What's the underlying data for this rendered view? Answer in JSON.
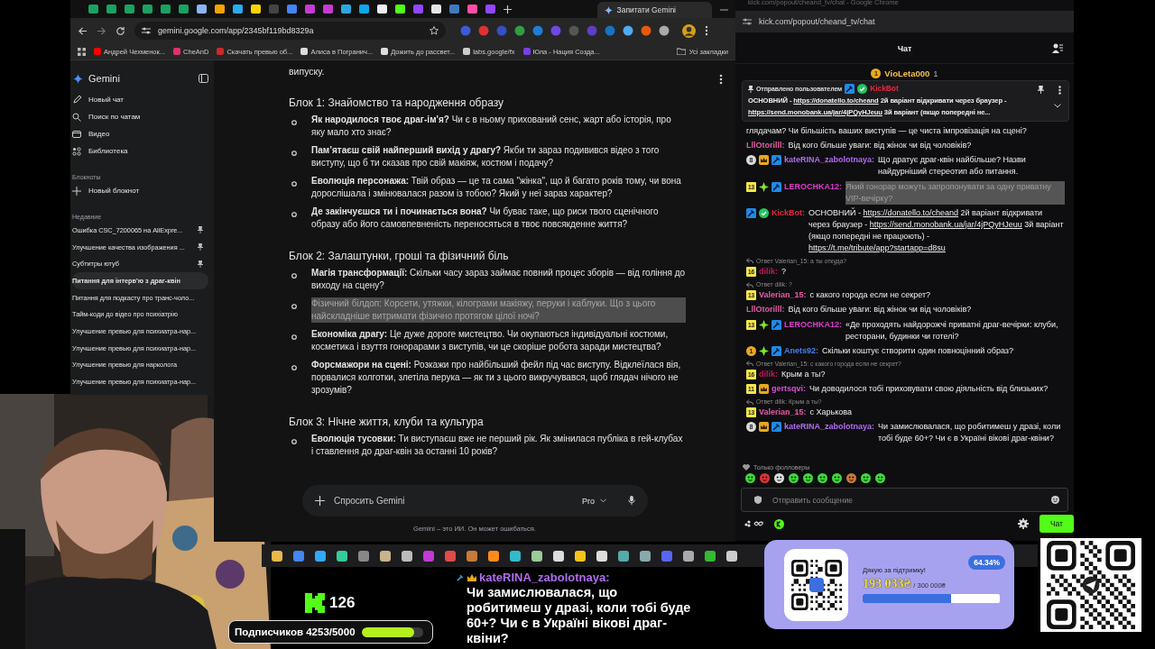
{
  "browser": {
    "tab_title": "Запитати Gemini",
    "address": "gemini.google.com/app/2345bf119bd8329a",
    "bookmarks": [
      "Андрей Чехменок...",
      "CheAnD",
      "Скачать превью об...",
      "Алиса в Погранич...",
      "Дожить до рассвет...",
      "labs.google/fx",
      "Юла - Нация Созда..."
    ],
    "all_bookmarks": "Усі закладки"
  },
  "gemini": {
    "logo": "Gemini",
    "nav": [
      {
        "kind": "new-chat",
        "label": "Новый чат"
      },
      {
        "kind": "search",
        "label": "Поиск по чатам"
      },
      {
        "kind": "video",
        "label": "Видео"
      },
      {
        "kind": "library",
        "label": "Библиотека"
      }
    ],
    "notebooks_heading": "Блокноты",
    "new_notebook": "Новый блокнот",
    "recent_heading": "Недавние",
    "recent": [
      {
        "title": "Ошибка CSC_7200065 на AliExpre...",
        "pinned": true,
        "selected": false
      },
      {
        "title": "Улучшение качества изображения ...",
        "pinned": true,
        "selected": false
      },
      {
        "title": "Субтитры ютуб",
        "pinned": true,
        "selected": false
      },
      {
        "title": "Питання для інтерв'ю з драг-квін",
        "pinned": false,
        "selected": true
      },
      {
        "title": "Питання для подкасту про транс-чоло...",
        "pinned": false,
        "selected": false
      },
      {
        "title": "Тайм-коди до відео про психіатрію",
        "pinned": false,
        "selected": false
      },
      {
        "title": "Улучшение превью для психиатра-нар...",
        "pinned": false,
        "selected": false
      },
      {
        "title": "Улучшение превью для психиатра-нар...",
        "pinned": false,
        "selected": false
      },
      {
        "title": "Улучшение превью для нарколога",
        "pinned": false,
        "selected": false
      },
      {
        "title": "Улучшение превью для психиатра-нар...",
        "pinned": false,
        "selected": false
      }
    ],
    "intro_tail": "випуску.",
    "blocks": [
      {
        "heading": "Блок 1: Знайомство та народження образу",
        "items": [
          {
            "text": "**Як народилося твоє драг-ім'я?** Чи є в ньому прихований сенс, жарт або історія, про яку мало хто знає?",
            "highlighted": false
          },
          {
            "text": "**Пам’ятаєш свій найперший вихід у драгу?** Якби ти зараз подивився відео з того виступу, що б ти сказав про свій макіяж, костюм і подачу?",
            "highlighted": false
          },
          {
            "text": "**Еволюція персонажа:** Твій образ — це та сама \"жінка\", що й багато років тому, чи вона дорослішала і змінювалася разом із тобою? Який у неї зараз характер?",
            "highlighted": false
          },
          {
            "text": "**Де закінчуєшся ти і починається вона?** Чи буває таке, що риси твого сценічного образу або його самовпевненість переносяться в твоє повсякденне життя?",
            "highlighted": false
          }
        ]
      },
      {
        "heading": "Блок 2: Залаштунки, гроші та фізичний біль",
        "items": [
          {
            "text": "**Магія трансформації:** Скільки часу зараз займає повний процес зборів — від гоління до виходу на сцену?",
            "highlighted": false
          },
          {
            "text": "Фізичний білдоп: Корсети, утяжки, кілограми макіяжу, перуки і каблуки. Що з цього найскладніше витримати фізично протягом цілої ночі?",
            "highlighted": true
          },
          {
            "text": "**Економіка драгу:** Це дуже дороге мистецтво. Чи окупаються індивідуальні костюми, косметика і взуття гонорарами з виступів, чи це скоріше робота заради мистецтва?",
            "highlighted": false
          },
          {
            "text": "**Форсмажори на сцені:** Розкажи про найбільший фейл під час виступу. Відклеїлася вія, порвалися колготки, злетіла перука — як ти з цього викручувався, щоб глядач нічого не зрозумів?",
            "highlighted": false
          }
        ]
      },
      {
        "heading": "Блок 3: Нічне життя, клуби та культура",
        "items": [
          {
            "text": "**Еволюція тусовки:** Ти виступаєш вже не перший рік. Як змінилася публіка в гей-клубах і ставлення до драг-квін за останні 10 років?",
            "highlighted": false
          }
        ]
      }
    ],
    "prompt": {
      "placeholder": "Спросить Gemini",
      "model": "Pro"
    },
    "disclaimer": "Gemini – это ИИ. Он может ошибаться."
  },
  "chat": {
    "window_title": "kick.com/popout/cheand_tv/chat - Google Chrome",
    "address": "kick.com/popout/cheand_tv/chat",
    "header": "Чат",
    "top_gifter": {
      "rank": "1",
      "name": "VioLeta000",
      "count": "1"
    },
    "pinned": {
      "label": "Отправлено пользователем",
      "user": "KickBot",
      "color": "#e5273b",
      "parts": [
        {
          "kind": "text",
          "text": "ОСНОВНИЙ - "
        },
        {
          "kind": "link",
          "text": "https://donatello.to/cheand"
        },
        {
          "kind": "text",
          "text": " 2й варіант відкривати через браузер - "
        },
        {
          "kind": "link",
          "text": "https://send.monobank.ua/jar/4jPQyHJeuu"
        },
        {
          "kind": "text",
          "text": " 3й варіант (якщо попередні не..."
        }
      ]
    },
    "messages": [
      {
        "parts": [
          {
            "kind": "text",
            "text": "глядачам? Чи більшість ваших виступів — це чиста імпровізація на сцені?"
          }
        ],
        "highlighted": false
      },
      {
        "user": "LllOtorilll:",
        "color": "#e05fa0",
        "parts": [
          {
            "kind": "text",
            "text": "Від кого більше уваги: від жінок чи від чоловіків?"
          }
        ],
        "highlighted": false
      },
      {
        "badges": [
          {
            "kind": "circle",
            "text": "8",
            "color": "#d9d9d9"
          },
          {
            "kind": "crown"
          },
          {
            "kind": "mod"
          }
        ],
        "user": "kateRINA_zabolotnaya:",
        "color": "#b06cf0",
        "parts": [
          {
            "kind": "text",
            "text": "Що дратує драг-квін найбільше? Назви найдурніший стереотип або питання."
          }
        ],
        "highlighted": false
      },
      {
        "badges": [
          {
            "kind": "months",
            "text": "13"
          },
          {
            "kind": "gem"
          },
          {
            "kind": "mod"
          }
        ],
        "user": "LEROCHKA12:",
        "color": "#e23bd0",
        "parts": [
          {
            "kind": "text",
            "text": "Який гонорар можуть запропонувати за одну приватну VIP-вечірку?"
          }
        ],
        "highlighted": true
      },
      {
        "badges": [
          {
            "kind": "mod"
          },
          {
            "kind": "verified"
          }
        ],
        "user": "KickBot:",
        "color": "#e5273b",
        "parts": [
          {
            "kind": "text",
            "text": "ОСНОВНИЙ - "
          },
          {
            "kind": "link",
            "text": "https://donatello.to/cheand"
          },
          {
            "kind": "text",
            "text": " 2й варіант відкривати через браузер - "
          },
          {
            "kind": "link",
            "text": "https://send.monobank.ua/jar/4jPQyHJeuu"
          },
          {
            "kind": "text",
            "text": " 3й варіант (якщо попередні не працюють) - "
          },
          {
            "kind": "link",
            "text": "https://t.me/tribute/app?startapp=d8su"
          }
        ],
        "highlighted": false
      },
      {
        "reply": "Ответ Valerian_15: а ты откуда?",
        "badges": [
          {
            "kind": "months",
            "text": "16"
          }
        ],
        "user": "dilik:",
        "color": "#c2185b",
        "parts": [
          {
            "kind": "text",
            "text": "?"
          }
        ],
        "highlighted": false
      },
      {
        "reply": "Ответ dilik: ?",
        "badges": [
          {
            "kind": "months",
            "text": "13"
          }
        ],
        "user": "Valerian_15:",
        "color": "#e65aa8",
        "parts": [
          {
            "kind": "text",
            "text": "с какого города если не секрет?"
          }
        ],
        "highlighted": false
      },
      {
        "user": "LllOtorilll:",
        "color": "#e05fa0",
        "parts": [
          {
            "kind": "text",
            "text": "Від кого більше уваги: від жінок чи від чоловіків?"
          }
        ],
        "highlighted": false
      },
      {
        "badges": [
          {
            "kind": "months",
            "text": "13"
          },
          {
            "kind": "gem"
          },
          {
            "kind": "mod"
          }
        ],
        "user": "LEROCHKA12:",
        "color": "#e23bd0",
        "parts": [
          {
            "kind": "text",
            "text": "«Де проходять найдорожчі приватні драг-вечірки: клуби, ресторани, будинки чи готелі?"
          }
        ],
        "highlighted": false
      },
      {
        "badges": [
          {
            "kind": "circle",
            "text": "1",
            "color": "#e8a820"
          },
          {
            "kind": "gem"
          },
          {
            "kind": "mod"
          }
        ],
        "user": "Anets92:",
        "color": "#4a7ff0",
        "parts": [
          {
            "kind": "text",
            "text": "Скільки коштує створити один повноцінний образ?"
          }
        ],
        "highlighted": false
      },
      {
        "reply": "Ответ Valerian_15: с какого города если не секрет?",
        "badges": [
          {
            "kind": "months",
            "text": "16"
          }
        ],
        "user": "dilik:",
        "color": "#c2185b",
        "parts": [
          {
            "kind": "text",
            "text": "Крым а ты?"
          }
        ],
        "highlighted": false
      },
      {
        "badges": [
          {
            "kind": "months",
            "text": "11"
          },
          {
            "kind": "crown"
          }
        ],
        "user": "gertsqvi:",
        "color": "#d94fd0",
        "parts": [
          {
            "kind": "text",
            "text": "Чи доводилося тобі приховувати свою діяльність від близьких?"
          }
        ],
        "highlighted": false
      },
      {
        "reply": "Ответ dilik: Крым а ты?",
        "badges": [
          {
            "kind": "months",
            "text": "13"
          }
        ],
        "user": "Valerian_15:",
        "color": "#e65aa8",
        "parts": [
          {
            "kind": "text",
            "text": "с Харькова"
          }
        ],
        "highlighted": false
      },
      {
        "badges": [
          {
            "kind": "circle",
            "text": "8",
            "color": "#d9d9d9"
          },
          {
            "kind": "crown"
          },
          {
            "kind": "mod"
          }
        ],
        "user": "kateRINA_zabolotnaya:",
        "color": "#b06cf0",
        "parts": [
          {
            "kind": "text",
            "text": "Чи замислювалася, що робитимеш у дразі, коли тобі буде 60+? Чи є в Україні вікові драг-квіни?"
          }
        ],
        "highlighted": false
      }
    ],
    "followers_only": "Только фолловеры",
    "input_placeholder": "Отправить сообщение",
    "send": "Чат"
  },
  "overlay": {
    "kick_count": "126",
    "subs": {
      "label": "Подписчиков 4253/5000",
      "level": 0.85
    },
    "alert": {
      "user": "kateRINA_zabolotnaya:",
      "color": "#b06cf0",
      "text": "Чи замислювалася, що робитимеш у дразі, коли тобі буде 60+? Чи є в Україні вікові драг-квіни?"
    },
    "donation": {
      "title": "Дякую за підтримку!",
      "percent": "64.34%",
      "raised": "193 033₴",
      "goal": "/ 300 000₴",
      "level": 0.6434
    }
  }
}
